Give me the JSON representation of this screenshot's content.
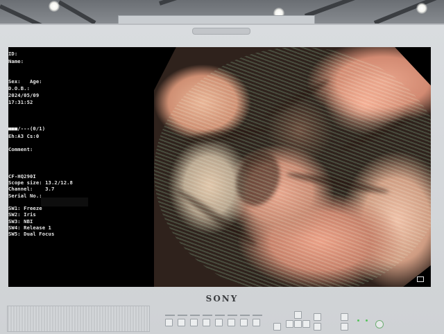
{
  "brand": "SONY",
  "osd": {
    "id_label": "ID:",
    "name_label": "Name:",
    "sex_age": "Sex:   Age:",
    "dob_label": "D.O.B.:",
    "date": "2024/05/09",
    "time": "17:31:52",
    "enhance_status": "■■■/---(0/1)",
    "eh_cs": "Eh:A3 Cs:0",
    "comment_label": "Comment:",
    "scope_model": "CF-HQ290I",
    "scope_size": "Scope size: 13.2/12.8",
    "channel": "Channel:    3.7",
    "serial_label": "Serial No.:",
    "sw1": "SW1: Freeze",
    "sw2": "SW2: Iris",
    "sw3": "SW3: NBI",
    "sw4": "SW4: Release 1",
    "sw5": "SW5: Dual Focus"
  },
  "colors": {
    "screen_bg": "#000000",
    "osd_text": "#e8e8e8",
    "bezel": "#d5d8db",
    "power_led": "#55c35b"
  },
  "icons": {
    "mode_indicator": "display-mode-icon",
    "power": "power-icon"
  }
}
